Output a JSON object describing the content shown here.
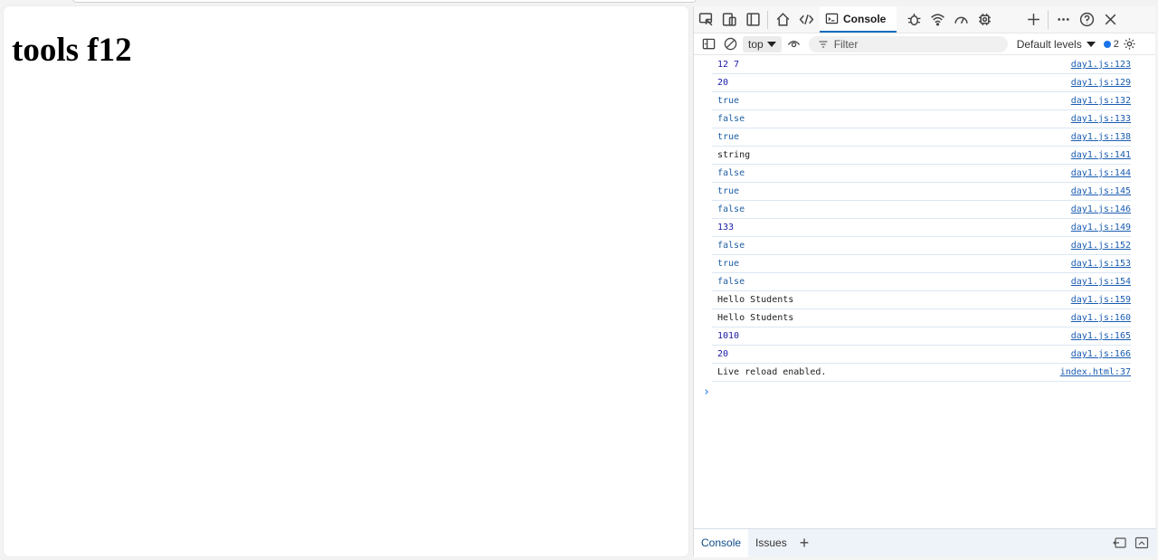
{
  "page": {
    "heading": "tools f12"
  },
  "devtools": {
    "tabs": {
      "console_label": "Console"
    },
    "toolbar": {
      "context": "top",
      "filter_placeholder": "Filter",
      "levels_label": "Default levels",
      "issues_count": "2"
    },
    "log": [
      {
        "msg": "12 7",
        "kind": "num",
        "src": "day1.js:123"
      },
      {
        "msg": "20",
        "kind": "num",
        "src": "day1.js:129"
      },
      {
        "msg": "true",
        "kind": "bool",
        "src": "day1.js:132"
      },
      {
        "msg": "false",
        "kind": "bool",
        "src": "day1.js:133"
      },
      {
        "msg": "true",
        "kind": "bool",
        "src": "day1.js:138"
      },
      {
        "msg": "string",
        "kind": "str",
        "src": "day1.js:141"
      },
      {
        "msg": "false",
        "kind": "bool",
        "src": "day1.js:144"
      },
      {
        "msg": "true",
        "kind": "bool",
        "src": "day1.js:145"
      },
      {
        "msg": "false",
        "kind": "bool",
        "src": "day1.js:146"
      },
      {
        "msg": "133",
        "kind": "num",
        "src": "day1.js:149"
      },
      {
        "msg": "false",
        "kind": "bool",
        "src": "day1.js:152"
      },
      {
        "msg": "true",
        "kind": "bool",
        "src": "day1.js:153"
      },
      {
        "msg": "false",
        "kind": "bool",
        "src": "day1.js:154"
      },
      {
        "msg": "Hello Students",
        "kind": "str",
        "src": "day1.js:159"
      },
      {
        "msg": "Hello Students",
        "kind": "str",
        "src": "day1.js:160"
      },
      {
        "msg": "1010",
        "kind": "num",
        "src": "day1.js:165"
      },
      {
        "msg": "20",
        "kind": "num",
        "src": "day1.js:166"
      },
      {
        "msg": "Live reload enabled.",
        "kind": "str",
        "src": "index.html:37"
      }
    ],
    "prompt_symbol": "›",
    "drawer": {
      "console_label": "Console",
      "issues_label": "Issues",
      "add_symbol": "+"
    }
  }
}
